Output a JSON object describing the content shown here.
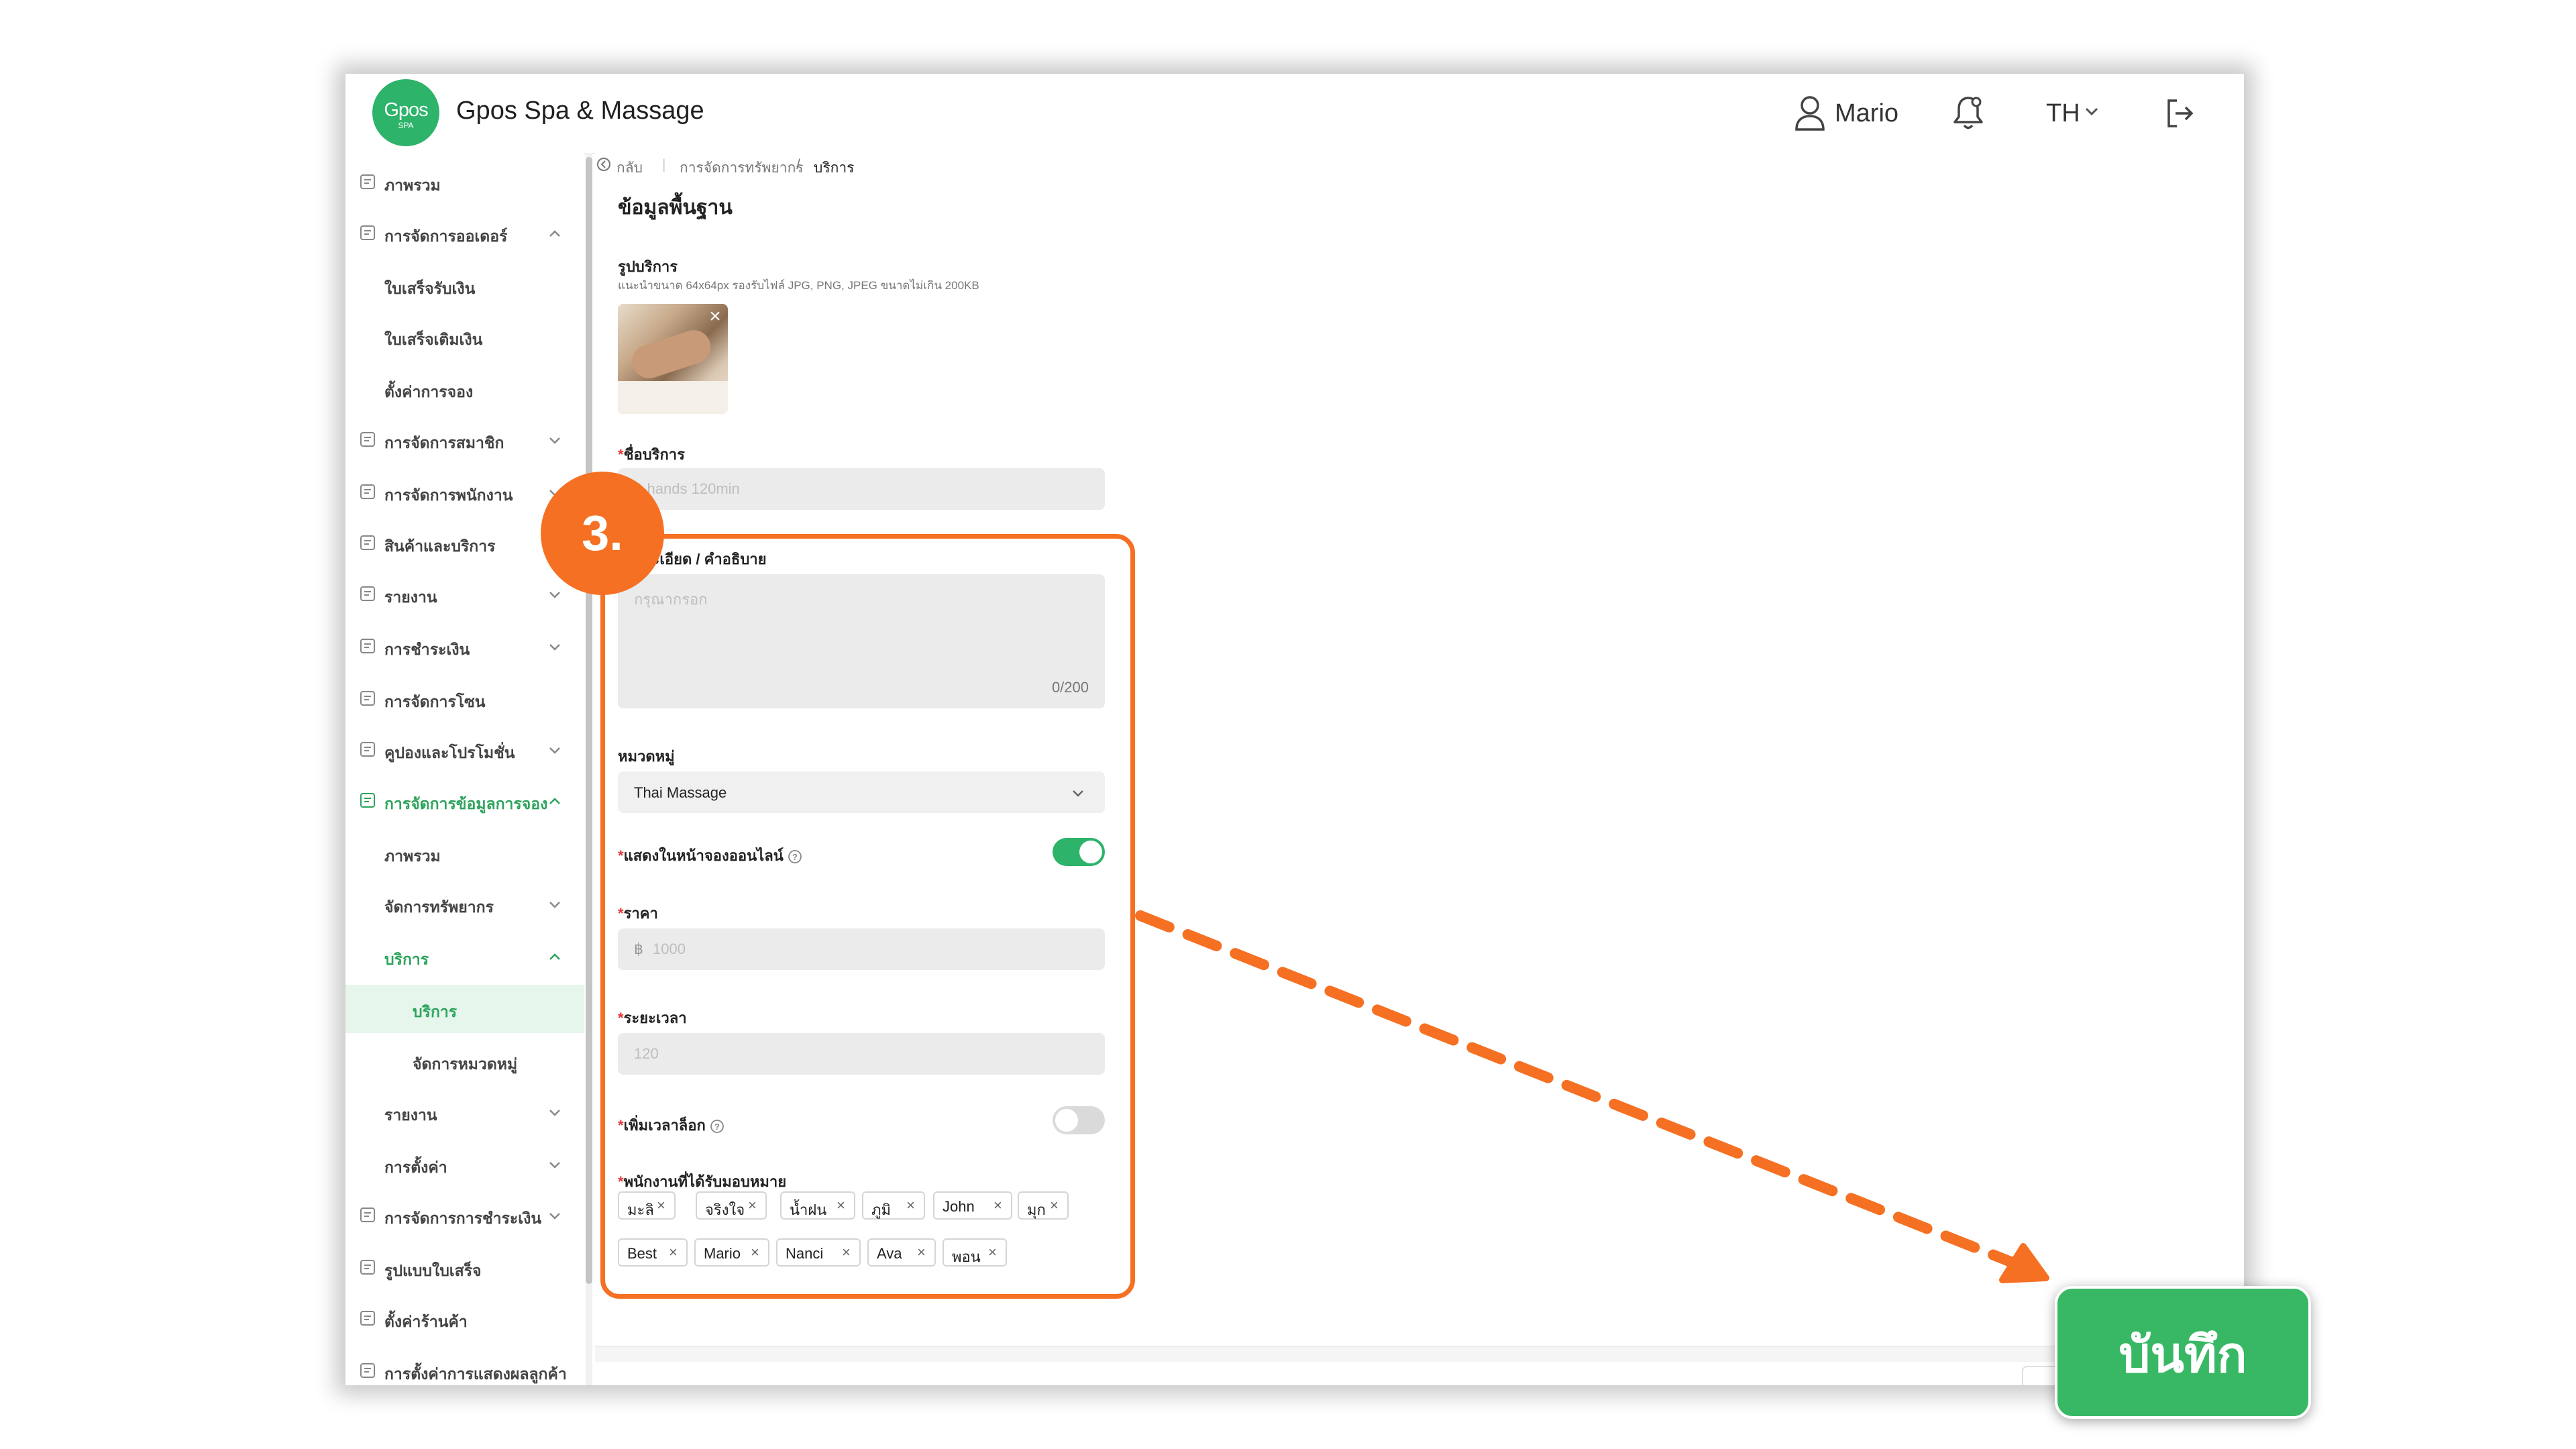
{
  "header": {
    "logo_main": "Gpos",
    "logo_sub": "SPA",
    "title": "Gpos Spa & Massage",
    "user_name": "Mario",
    "language": "TH"
  },
  "sidebar": {
    "items": [
      {
        "label": "ภาพรวม",
        "icon": "overview-icon",
        "chevron": "none"
      },
      {
        "label": "การจัดการออเดอร์",
        "icon": "order-icon",
        "chevron": "up"
      },
      {
        "label": "ใบเสร็จรับเงิน",
        "chevron": "none"
      },
      {
        "label": "ใบเสร็จเติมเงิน",
        "chevron": "none"
      },
      {
        "label": "ตั้งค่าการจอง",
        "chevron": "none"
      },
      {
        "label": "การจัดการสมาชิก",
        "icon": "member-icon",
        "chevron": "down"
      },
      {
        "label": "การจัดการพนักงาน",
        "icon": "staff-icon",
        "chevron": "down"
      },
      {
        "label": "สินค้าและบริการ",
        "icon": "product-icon",
        "chevron": "none"
      },
      {
        "label": "รายงาน",
        "icon": "report-icon",
        "chevron": "down"
      },
      {
        "label": "การชำระเงิน",
        "icon": "payment-icon",
        "chevron": "down"
      },
      {
        "label": "การจัดการโซน",
        "icon": "zone-icon",
        "chevron": "none"
      },
      {
        "label": "คูปองและโปรโมชั่น",
        "icon": "coupon-icon",
        "chevron": "down"
      },
      {
        "label": "การจัดการข้อมูลการจอง",
        "icon": "booking-icon",
        "chevron": "up"
      },
      {
        "label": "ภาพรวม",
        "chevron": "none"
      },
      {
        "label": "จัดการทรัพยากร",
        "chevron": "down"
      },
      {
        "label": "บริการ",
        "chevron": "up"
      },
      {
        "label": "บริการ",
        "chevron": "none"
      },
      {
        "label": "จัดการหมวดหมู่",
        "chevron": "none"
      },
      {
        "label": "รายงาน",
        "chevron": "down"
      },
      {
        "label": "การตั้งค่า",
        "chevron": "down"
      },
      {
        "label": "การจัดการการชำระเงิน",
        "icon": "payment-manage-icon",
        "chevron": "down"
      },
      {
        "label": "รูปแบบใบเสร็จ",
        "icon": "receipt-format-icon",
        "chevron": "none"
      },
      {
        "label": "ตั้งค่าร้านค้า",
        "icon": "shop-settings-icon",
        "chevron": "none"
      },
      {
        "label": "การตั้งค่าการแสดงผลลูกค้า",
        "icon": "customer-display-icon",
        "chevron": "none"
      }
    ]
  },
  "breadcrumb": {
    "back": "กลับ",
    "parent": "การจัดการทรัพยากร",
    "separator": "/",
    "current": "บริการ"
  },
  "form": {
    "section_title": "ข้อมูลพื้นฐาน",
    "image_label": "รูปบริการ",
    "image_hint": "แนะนำขนาด 64x64px รองรับไฟล์ JPG, PNG, JPEG ขนาดไม่เกิน 200KB",
    "name_label": "ชื่อบริการ",
    "name_placeholder": "4-hands 120min",
    "description_label": "รายละเอียด / คำอธิบาย",
    "description_placeholder": "กรุณากรอก",
    "description_count": "0/200",
    "category_label": "หมวดหมู่",
    "category_value": "Thai Massage",
    "show_online_label": "แสดงในหน้าจองออนไลน์",
    "show_online_on": true,
    "price_label": "ราคา",
    "price_prefix": "฿",
    "price_placeholder": "1000",
    "duration_label": "ระยะเวลา",
    "duration_placeholder": "120",
    "lock_time_label": "เพิ่มเวลาล็อก",
    "lock_time_on": false,
    "staff_label": "พนักงานที่ได้รับมอบหมาย",
    "staff_tags": [
      "มะลิ",
      "จริงใจ",
      "น้ำฝน",
      "ภูมิ",
      "John",
      "มุก",
      "Best",
      "Mario",
      "Nanci",
      "Ava",
      "พอน"
    ]
  },
  "annotation": {
    "step": "3.",
    "save_label": "บันทึก"
  },
  "colors": {
    "brand_green": "#2db36a",
    "annotation_orange": "#f57023",
    "save_green": "#38b865"
  }
}
